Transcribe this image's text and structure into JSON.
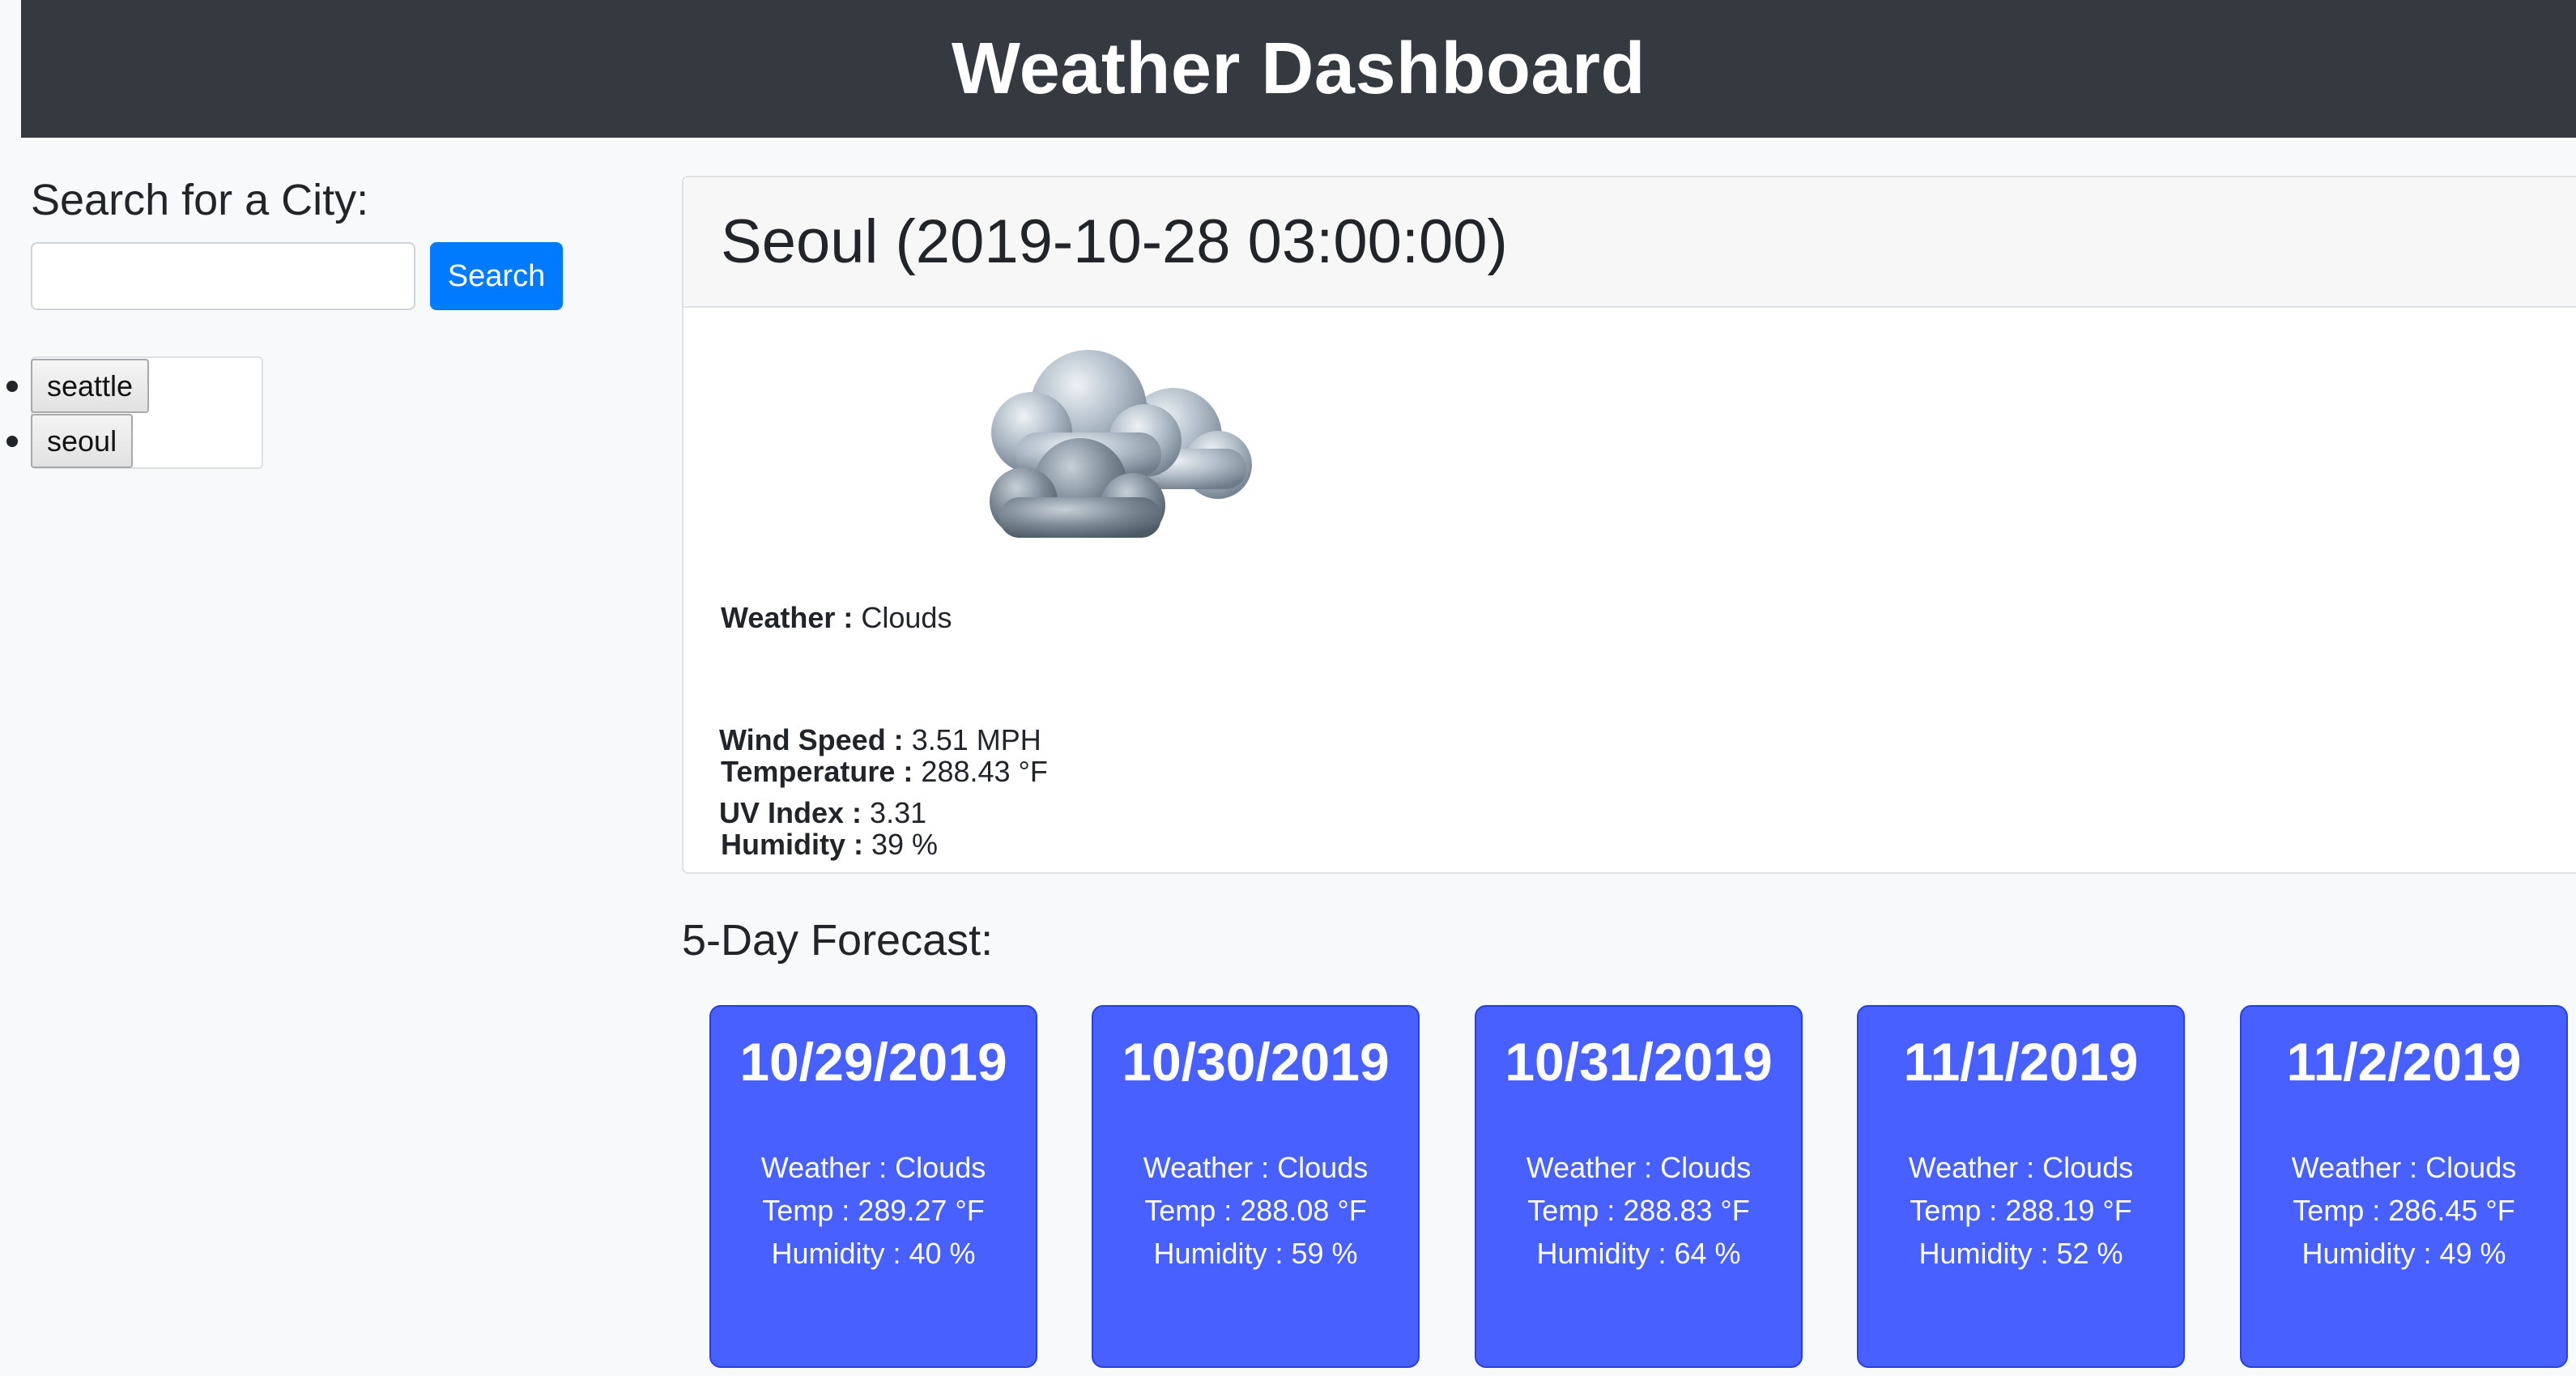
{
  "header": {
    "title": "Weather Dashboard"
  },
  "search": {
    "title": "Search for a City:",
    "input_value": "",
    "button_label": "Search"
  },
  "history": {
    "items": [
      {
        "label": "seattle"
      },
      {
        "label": "seoul"
      }
    ]
  },
  "current": {
    "title": "Seoul (2019-10-28 03:00:00)",
    "weather_label": "Weather :",
    "weather_value": "Clouds",
    "icon": "clouds-icon",
    "temperature_label": "Temperature :",
    "temperature_value": "288.43 °F",
    "humidity_label": "Humidity :",
    "humidity_value": "39 %",
    "wind_label": "Wind Speed :",
    "wind_value": "3.51 MPH",
    "uv_label": "UV Index :",
    "uv_value": "3.31"
  },
  "forecast": {
    "title": "5-Day Forecast:",
    "cards": [
      {
        "date": "10/29/2019",
        "weather": "Weather : Clouds",
        "temp": "Temp : 289.27 °F",
        "humidity": "Humidity : 40 %"
      },
      {
        "date": "10/30/2019",
        "weather": "Weather : Clouds",
        "temp": "Temp : 288.08 °F",
        "humidity": "Humidity : 59 %"
      },
      {
        "date": "10/31/2019",
        "weather": "Weather : Clouds",
        "temp": "Temp : 288.83 °F",
        "humidity": "Humidity : 64 %"
      },
      {
        "date": "11/1/2019",
        "weather": "Weather : Clouds",
        "temp": "Temp : 288.19 °F",
        "humidity": "Humidity : 52 %"
      },
      {
        "date": "11/2/2019",
        "weather": "Weather : Clouds",
        "temp": "Temp : 286.45 °F",
        "humidity": "Humidity : 49 %"
      }
    ]
  },
  "colors": {
    "header_bg": "#343a40",
    "primary_button": "#007bff",
    "forecast_card": "#4760ff",
    "page_bg": "#f8f9fa"
  }
}
